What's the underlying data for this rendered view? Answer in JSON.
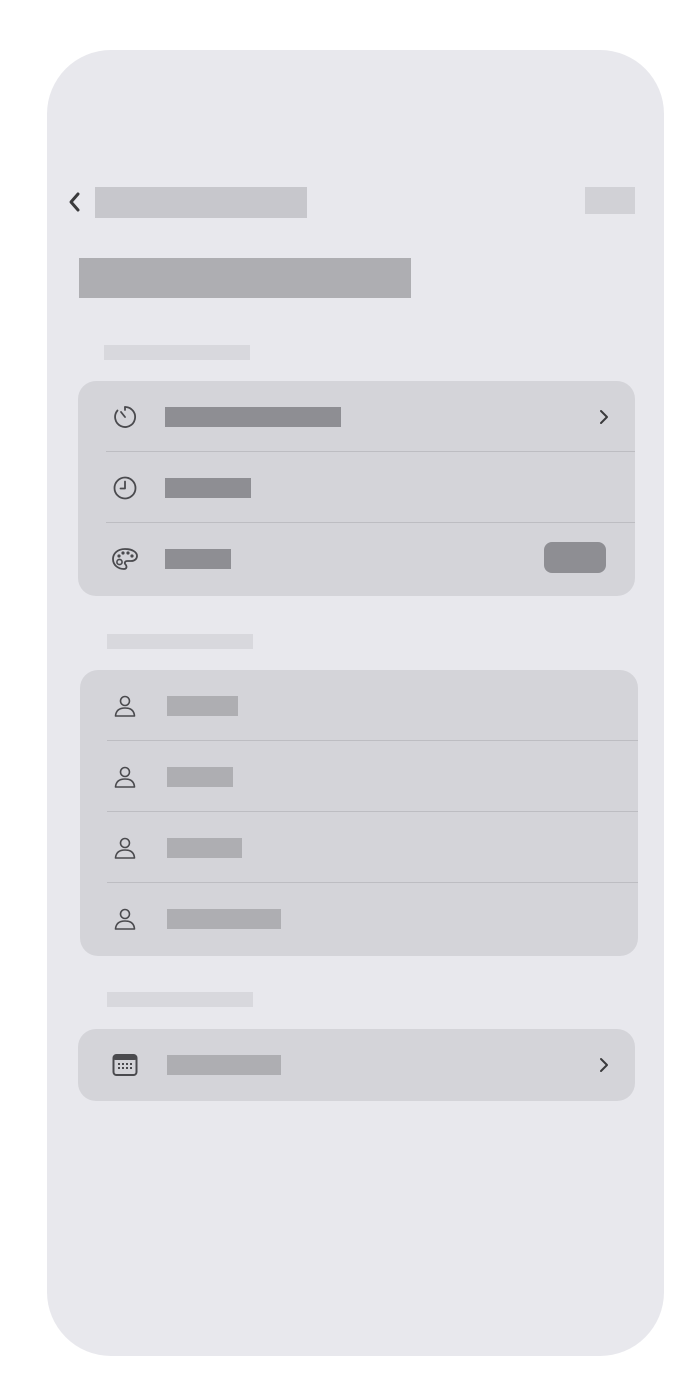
{
  "nav": {
    "back_icon": "chevron-left-icon",
    "title": "",
    "action_label": ""
  },
  "page": {
    "large_title": ""
  },
  "sections": [
    {
      "header": "",
      "rows": [
        {
          "icon": "timer-icon",
          "label": "",
          "accessory": "chevron-right-icon"
        },
        {
          "icon": "clock-icon",
          "label": ""
        },
        {
          "icon": "palette-icon",
          "label": "",
          "accessory": "toggle"
        }
      ]
    },
    {
      "header": "",
      "rows": [
        {
          "icon": "person-icon",
          "label": ""
        },
        {
          "icon": "person-icon",
          "label": ""
        },
        {
          "icon": "person-icon",
          "label": ""
        },
        {
          "icon": "person-icon",
          "label": ""
        }
      ]
    },
    {
      "header": "",
      "rows": [
        {
          "icon": "calendar-icon",
          "label": "",
          "accessory": "chevron-right-icon"
        }
      ]
    }
  ],
  "colors": {
    "screen_background": "#e8e8ed",
    "group_background": "#d4d4d9",
    "placeholder_dark": "#8e8e93",
    "placeholder_light": "#aeaeb2",
    "separator": "#bdbdc2"
  }
}
